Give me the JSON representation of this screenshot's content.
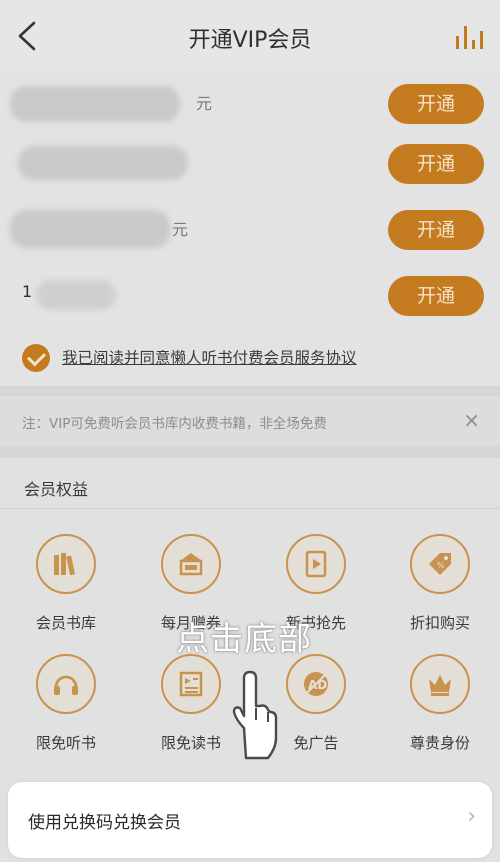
{
  "header": {
    "title": "开通VIP会员",
    "back_icon": "chevron-left-icon",
    "stats_icon": "bar-chart-icon"
  },
  "plans": [
    {
      "suffix": "元",
      "button_label": "开通"
    },
    {
      "suffix": "",
      "button_label": "开通"
    },
    {
      "suffix": "元",
      "button_label": "开通"
    },
    {
      "prefix": "1",
      "button_label": "开通"
    }
  ],
  "agreement": {
    "checked": true,
    "text": "我已阅读并同意懒人听书付费会员服务协议"
  },
  "note": {
    "text": "注：VIP可免费听会员书库内收费书籍，非全场免费",
    "close": "×"
  },
  "benefits": {
    "title": "会员权益",
    "items": [
      {
        "label": "会员书库",
        "icon": "books-icon"
      },
      {
        "label": "每月赠券",
        "icon": "ticket-icon"
      },
      {
        "label": "新书抢先",
        "icon": "new-book-icon"
      },
      {
        "label": "折扣购买",
        "icon": "discount-tag-icon"
      },
      {
        "label": "限免听书",
        "icon": "headphones-icon"
      },
      {
        "label": "限免读书",
        "icon": "reading-icon"
      },
      {
        "label": "免广告",
        "icon": "no-ads-icon"
      },
      {
        "label": "尊贵身份",
        "icon": "crown-icon"
      }
    ]
  },
  "overlay": {
    "hint_text": "点击底部",
    "pointer_icon": "hand-pointer-icon"
  },
  "redeem": {
    "label": "使用兑换码兑换会员",
    "chevron": "›"
  },
  "colors": {
    "accent": "#c47a1f",
    "accent_text": "#f4e3c8"
  }
}
